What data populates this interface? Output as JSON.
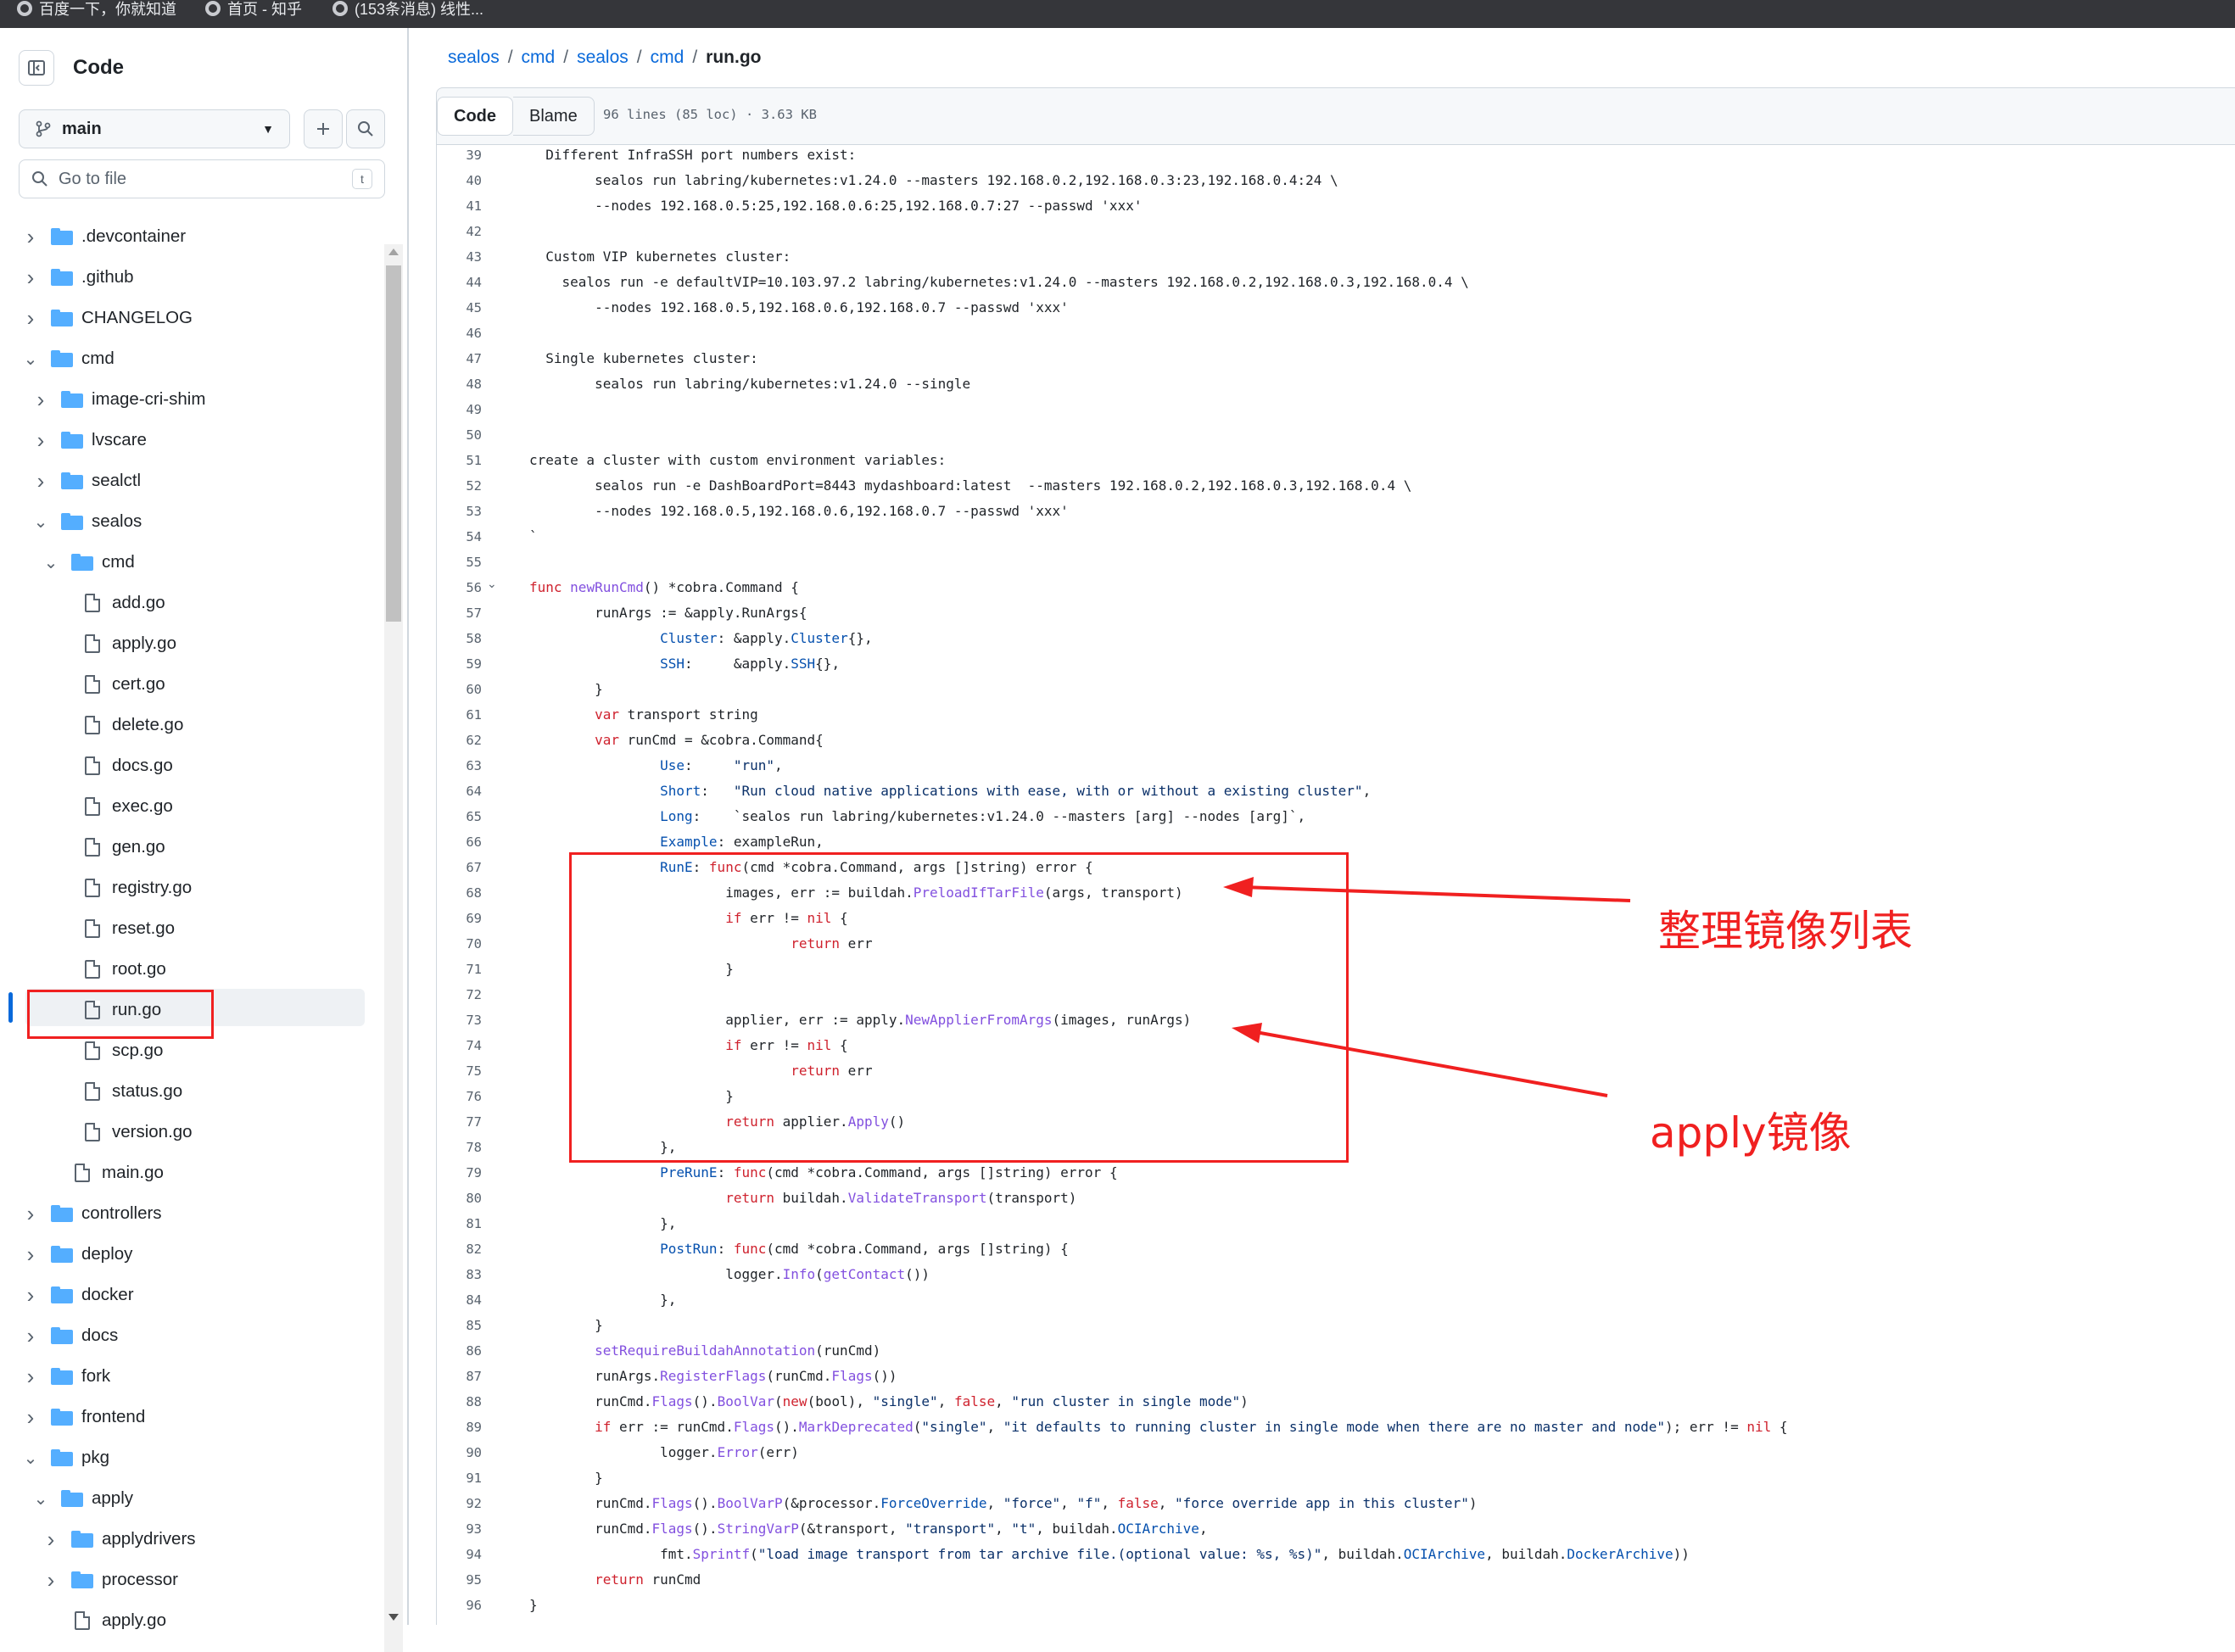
{
  "bookmarks": [
    "百度一下，你就知道",
    "首页 - 知乎",
    "(153条消息) 线性..."
  ],
  "sidebar": {
    "title": "Code",
    "branch": "main",
    "goto_file_placeholder": "Go to file",
    "goto_file_shortcut": "t",
    "tree": [
      {
        "label": ".devcontainer",
        "type": "folder",
        "depth": 0,
        "expanded": false
      },
      {
        "label": ".github",
        "type": "folder",
        "depth": 0,
        "expanded": false
      },
      {
        "label": "CHANGELOG",
        "type": "folder",
        "depth": 0,
        "expanded": false
      },
      {
        "label": "cmd",
        "type": "folder",
        "depth": 0,
        "expanded": true
      },
      {
        "label": "image-cri-shim",
        "type": "folder",
        "depth": 1,
        "expanded": false
      },
      {
        "label": "lvscare",
        "type": "folder",
        "depth": 1,
        "expanded": false
      },
      {
        "label": "sealctl",
        "type": "folder",
        "depth": 1,
        "expanded": false
      },
      {
        "label": "sealos",
        "type": "folder",
        "depth": 1,
        "expanded": true
      },
      {
        "label": "cmd",
        "type": "folder",
        "depth": 2,
        "expanded": true
      },
      {
        "label": "add.go",
        "type": "file",
        "depth": 3
      },
      {
        "label": "apply.go",
        "type": "file",
        "depth": 3
      },
      {
        "label": "cert.go",
        "type": "file",
        "depth": 3
      },
      {
        "label": "delete.go",
        "type": "file",
        "depth": 3
      },
      {
        "label": "docs.go",
        "type": "file",
        "depth": 3
      },
      {
        "label": "exec.go",
        "type": "file",
        "depth": 3
      },
      {
        "label": "gen.go",
        "type": "file",
        "depth": 3
      },
      {
        "label": "registry.go",
        "type": "file",
        "depth": 3
      },
      {
        "label": "reset.go",
        "type": "file",
        "depth": 3
      },
      {
        "label": "root.go",
        "type": "file",
        "depth": 3
      },
      {
        "label": "run.go",
        "type": "file",
        "depth": 3,
        "selected": true
      },
      {
        "label": "scp.go",
        "type": "file",
        "depth": 3
      },
      {
        "label": "status.go",
        "type": "file",
        "depth": 3
      },
      {
        "label": "version.go",
        "type": "file",
        "depth": 3
      },
      {
        "label": "main.go",
        "type": "file",
        "depth": 2
      },
      {
        "label": "controllers",
        "type": "folder",
        "depth": 0,
        "expanded": false
      },
      {
        "label": "deploy",
        "type": "folder",
        "depth": 0,
        "expanded": false
      },
      {
        "label": "docker",
        "type": "folder",
        "depth": 0,
        "expanded": false
      },
      {
        "label": "docs",
        "type": "folder",
        "depth": 0,
        "expanded": false
      },
      {
        "label": "fork",
        "type": "folder",
        "depth": 0,
        "expanded": false
      },
      {
        "label": "frontend",
        "type": "folder",
        "depth": 0,
        "expanded": false
      },
      {
        "label": "pkg",
        "type": "folder",
        "depth": 0,
        "expanded": true
      },
      {
        "label": "apply",
        "type": "folder",
        "depth": 1,
        "expanded": true
      },
      {
        "label": "applydrivers",
        "type": "folder",
        "depth": 2,
        "expanded": false
      },
      {
        "label": "processor",
        "type": "folder",
        "depth": 2,
        "expanded": false
      },
      {
        "label": "apply.go",
        "type": "file",
        "depth": 2
      }
    ]
  },
  "breadcrumb": {
    "items": [
      "sealos",
      "cmd",
      "sealos",
      "cmd"
    ],
    "current": "run.go",
    "separator": "/"
  },
  "toolbar": {
    "code_tab": "Code",
    "blame_tab": "Blame",
    "file_info": "96 lines (85 loc) · 3.63 KB"
  },
  "code": {
    "lines": [
      {
        "n": "39",
        "t": "  Different InfraSSH port numbers exist:"
      },
      {
        "n": "40",
        "t": "        sealos run labring/kubernetes:v1.24.0 --masters 192.168.0.2,192.168.0.3:23,192.168.0.4:24 \\"
      },
      {
        "n": "41",
        "t": "        --nodes 192.168.0.5:25,192.168.0.6:25,192.168.0.7:27 --passwd 'xxx'"
      },
      {
        "n": "42",
        "t": ""
      },
      {
        "n": "43",
        "t": "  Custom VIP kubernetes cluster:"
      },
      {
        "n": "44",
        "t": "    sealos run -e defaultVIP=10.103.97.2 labring/kubernetes:v1.24.0 --masters 192.168.0.2,192.168.0.3,192.168.0.4 \\"
      },
      {
        "n": "45",
        "t": "        --nodes 192.168.0.5,192.168.0.6,192.168.0.7 --passwd 'xxx'"
      },
      {
        "n": "46",
        "t": ""
      },
      {
        "n": "47",
        "t": "  Single kubernetes cluster:"
      },
      {
        "n": "48",
        "t": "        sealos run labring/kubernetes:v1.24.0 --single"
      },
      {
        "n": "49",
        "t": ""
      },
      {
        "n": "50",
        "t": ""
      },
      {
        "n": "51",
        "t": "create a cluster with custom environment variables:"
      },
      {
        "n": "52",
        "t": "        sealos run -e DashBoardPort=8443 mydashboard:latest  --masters 192.168.0.2,192.168.0.3,192.168.0.4 \\"
      },
      {
        "n": "53",
        "t": "        --nodes 192.168.0.5,192.168.0.6,192.168.0.7 --passwd 'xxx'"
      },
      {
        "n": "54",
        "t": "`"
      },
      {
        "n": "55",
        "t": ""
      },
      {
        "n": "56",
        "t": "func newRunCmd() *cobra.Command {"
      },
      {
        "n": "57",
        "t": "        runArgs := &apply.RunArgs{"
      },
      {
        "n": "58",
        "t": "                Cluster: &apply.Cluster{},"
      },
      {
        "n": "59",
        "t": "                SSH:     &apply.SSH{},"
      },
      {
        "n": "60",
        "t": "        }"
      },
      {
        "n": "61",
        "t": "        var transport string"
      },
      {
        "n": "62",
        "t": "        var runCmd = &cobra.Command{"
      },
      {
        "n": "63",
        "t": "                Use:     \"run\","
      },
      {
        "n": "64",
        "t": "                Short:   \"Run cloud native applications with ease, with or without a existing cluster\","
      },
      {
        "n": "65",
        "t": "                Long:    `sealos run labring/kubernetes:v1.24.0 --masters [arg] --nodes [arg]`,"
      },
      {
        "n": "66",
        "t": "                Example: exampleRun,"
      },
      {
        "n": "67",
        "t": "                RunE: func(cmd *cobra.Command, args []string) error {"
      },
      {
        "n": "68",
        "t": "                        images, err := buildah.PreloadIfTarFile(args, transport)"
      },
      {
        "n": "69",
        "t": "                        if err != nil {"
      },
      {
        "n": "70",
        "t": "                                return err"
      },
      {
        "n": "71",
        "t": "                        }"
      },
      {
        "n": "72",
        "t": ""
      },
      {
        "n": "73",
        "t": "                        applier, err := apply.NewApplierFromArgs(images, runArgs)"
      },
      {
        "n": "74",
        "t": "                        if err != nil {"
      },
      {
        "n": "75",
        "t": "                                return err"
      },
      {
        "n": "76",
        "t": "                        }"
      },
      {
        "n": "77",
        "t": "                        return applier.Apply()"
      },
      {
        "n": "78",
        "t": "                },"
      },
      {
        "n": "79",
        "t": "                PreRunE: func(cmd *cobra.Command, args []string) error {"
      },
      {
        "n": "80",
        "t": "                        return buildah.ValidateTransport(transport)"
      },
      {
        "n": "81",
        "t": "                },"
      },
      {
        "n": "82",
        "t": "                PostRun: func(cmd *cobra.Command, args []string) {"
      },
      {
        "n": "83",
        "t": "                        logger.Info(getContact())"
      },
      {
        "n": "84",
        "t": "                },"
      },
      {
        "n": "85",
        "t": "        }"
      },
      {
        "n": "86",
        "t": "        setRequireBuildahAnnotation(runCmd)"
      },
      {
        "n": "87",
        "t": "        runArgs.RegisterFlags(runCmd.Flags())"
      },
      {
        "n": "88",
        "t": "        runCmd.Flags().BoolVar(new(bool), \"single\", false, \"run cluster in single mode\")"
      },
      {
        "n": "89",
        "t": "        if err := runCmd.Flags().MarkDeprecated(\"single\", \"it defaults to running cluster in single mode when there are no master and node\"); err != nil {"
      },
      {
        "n": "90",
        "t": "                logger.Error(err)"
      },
      {
        "n": "91",
        "t": "        }"
      },
      {
        "n": "92",
        "t": "        runCmd.Flags().BoolVarP(&processor.ForceOverride, \"force\", \"f\", false, \"force override app in this cluster\")"
      },
      {
        "n": "93",
        "t": "        runCmd.Flags().StringVarP(&transport, \"transport\", \"t\", buildah.OCIArchive,"
      },
      {
        "n": "94",
        "t": "                fmt.Sprintf(\"load image transport from tar archive file.(optional value: %s, %s)\", buildah.OCIArchive, buildah.DockerArchive))"
      },
      {
        "n": "95",
        "t": "        return runCmd"
      },
      {
        "n": "96",
        "t": "}"
      }
    ]
  },
  "annotations": {
    "label_1": "整理镜像列表",
    "label_2": "apply镜像",
    "color": "#f02020"
  },
  "colors": {
    "accent": "#0969da",
    "keyword": "#cf222e",
    "function": "#8250df",
    "constant": "#0550ae",
    "string": "#0a3069"
  }
}
